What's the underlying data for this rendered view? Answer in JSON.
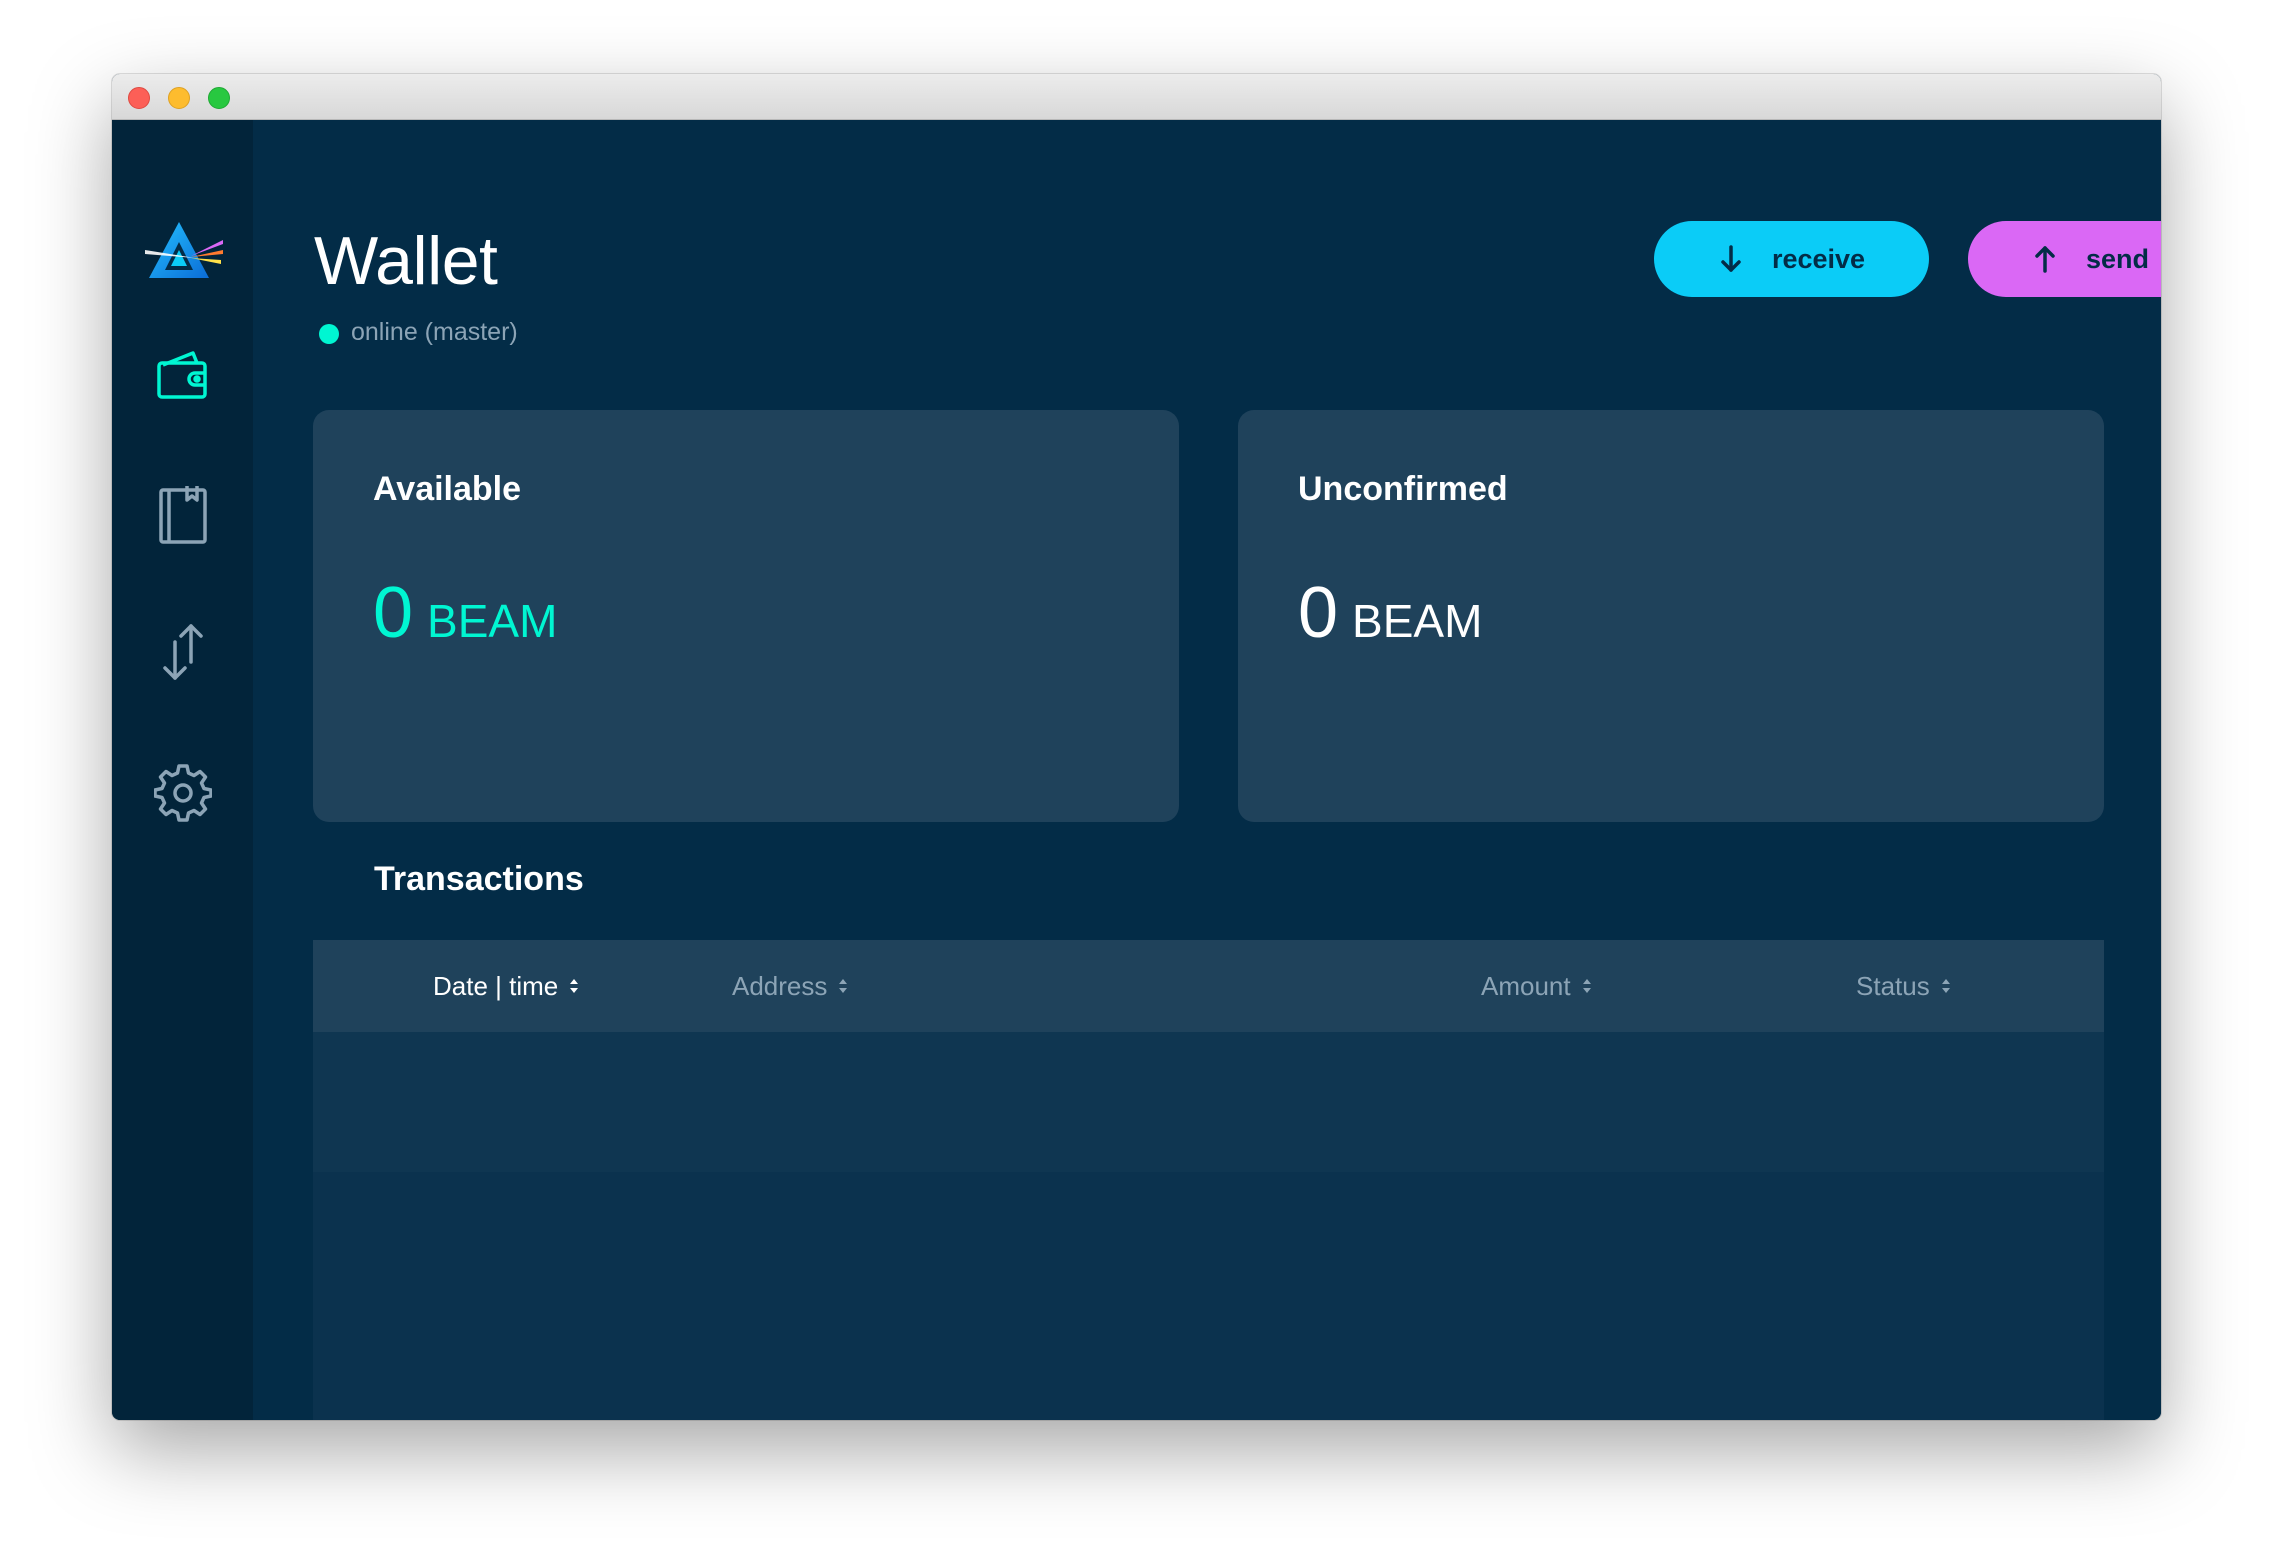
{
  "window": {
    "controls": [
      "close",
      "minimize",
      "zoom"
    ]
  },
  "sidebar": {
    "logo": "beam-logo",
    "items": [
      {
        "name": "wallet",
        "icon": "wallet-icon",
        "active": true
      },
      {
        "name": "address-book",
        "icon": "notebook-icon",
        "active": false
      },
      {
        "name": "utxo",
        "icon": "transfer-arrows-icon",
        "active": false
      },
      {
        "name": "settings",
        "icon": "gear-icon",
        "active": false
      }
    ]
  },
  "header": {
    "title": "Wallet",
    "status": "online (master)",
    "status_color": "#00f6d2",
    "receive_label": "receive",
    "send_label": "send",
    "receive_color": "#0bccf7",
    "send_color": "#da68f5"
  },
  "cards": {
    "available": {
      "label": "Available",
      "amount": "0",
      "unit": "BEAM",
      "color": "#00f6d2"
    },
    "unconfirmed": {
      "label": "Unconfirmed",
      "amount": "0",
      "unit": "BEAM",
      "color": "#ffffff"
    }
  },
  "transactions": {
    "title": "Transactions",
    "columns": [
      "Date | time",
      "Address",
      "Amount",
      "Status"
    ],
    "active_column": "Date | time",
    "rows": []
  }
}
